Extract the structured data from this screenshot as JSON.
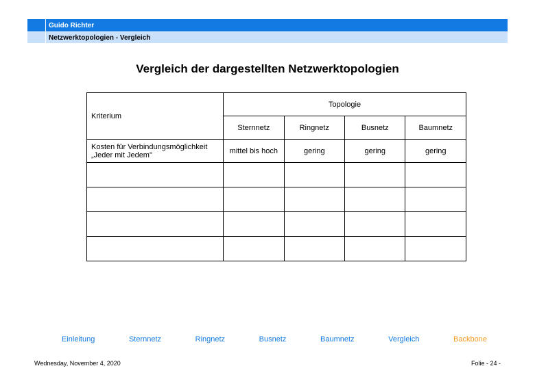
{
  "header": {
    "author": "Guido Richter",
    "subtitle": "Netzwerktopologien  - Vergleich"
  },
  "title": "Vergleich der dargestellten Netzwerktopologien",
  "table": {
    "kriterium_label": "Kriterium",
    "topologie_label": "Topologie",
    "cols": {
      "stern": "Sternnetz",
      "ring": "Ringnetz",
      "bus": "Busnetz",
      "baum": "Baumnetz"
    },
    "rows": [
      {
        "kriterium": "Kosten für Verbindungsmöglichkeit „Jeder mit Jedem\"",
        "stern": "mittel bis hoch",
        "ring": "gering",
        "bus": "gering",
        "baum": "gering"
      }
    ]
  },
  "nav": {
    "items": [
      {
        "label": "Einleitung",
        "active": false
      },
      {
        "label": "Sternnetz",
        "active": false
      },
      {
        "label": "Ringnetz",
        "active": false
      },
      {
        "label": "Busnetz",
        "active": false
      },
      {
        "label": "Baumnetz",
        "active": false
      },
      {
        "label": "Vergleich",
        "active": false
      },
      {
        "label": "Backbone",
        "active": true
      }
    ]
  },
  "footer": {
    "date": "Wednesday, November 4, 2020",
    "page": "Folie - 24 -"
  }
}
